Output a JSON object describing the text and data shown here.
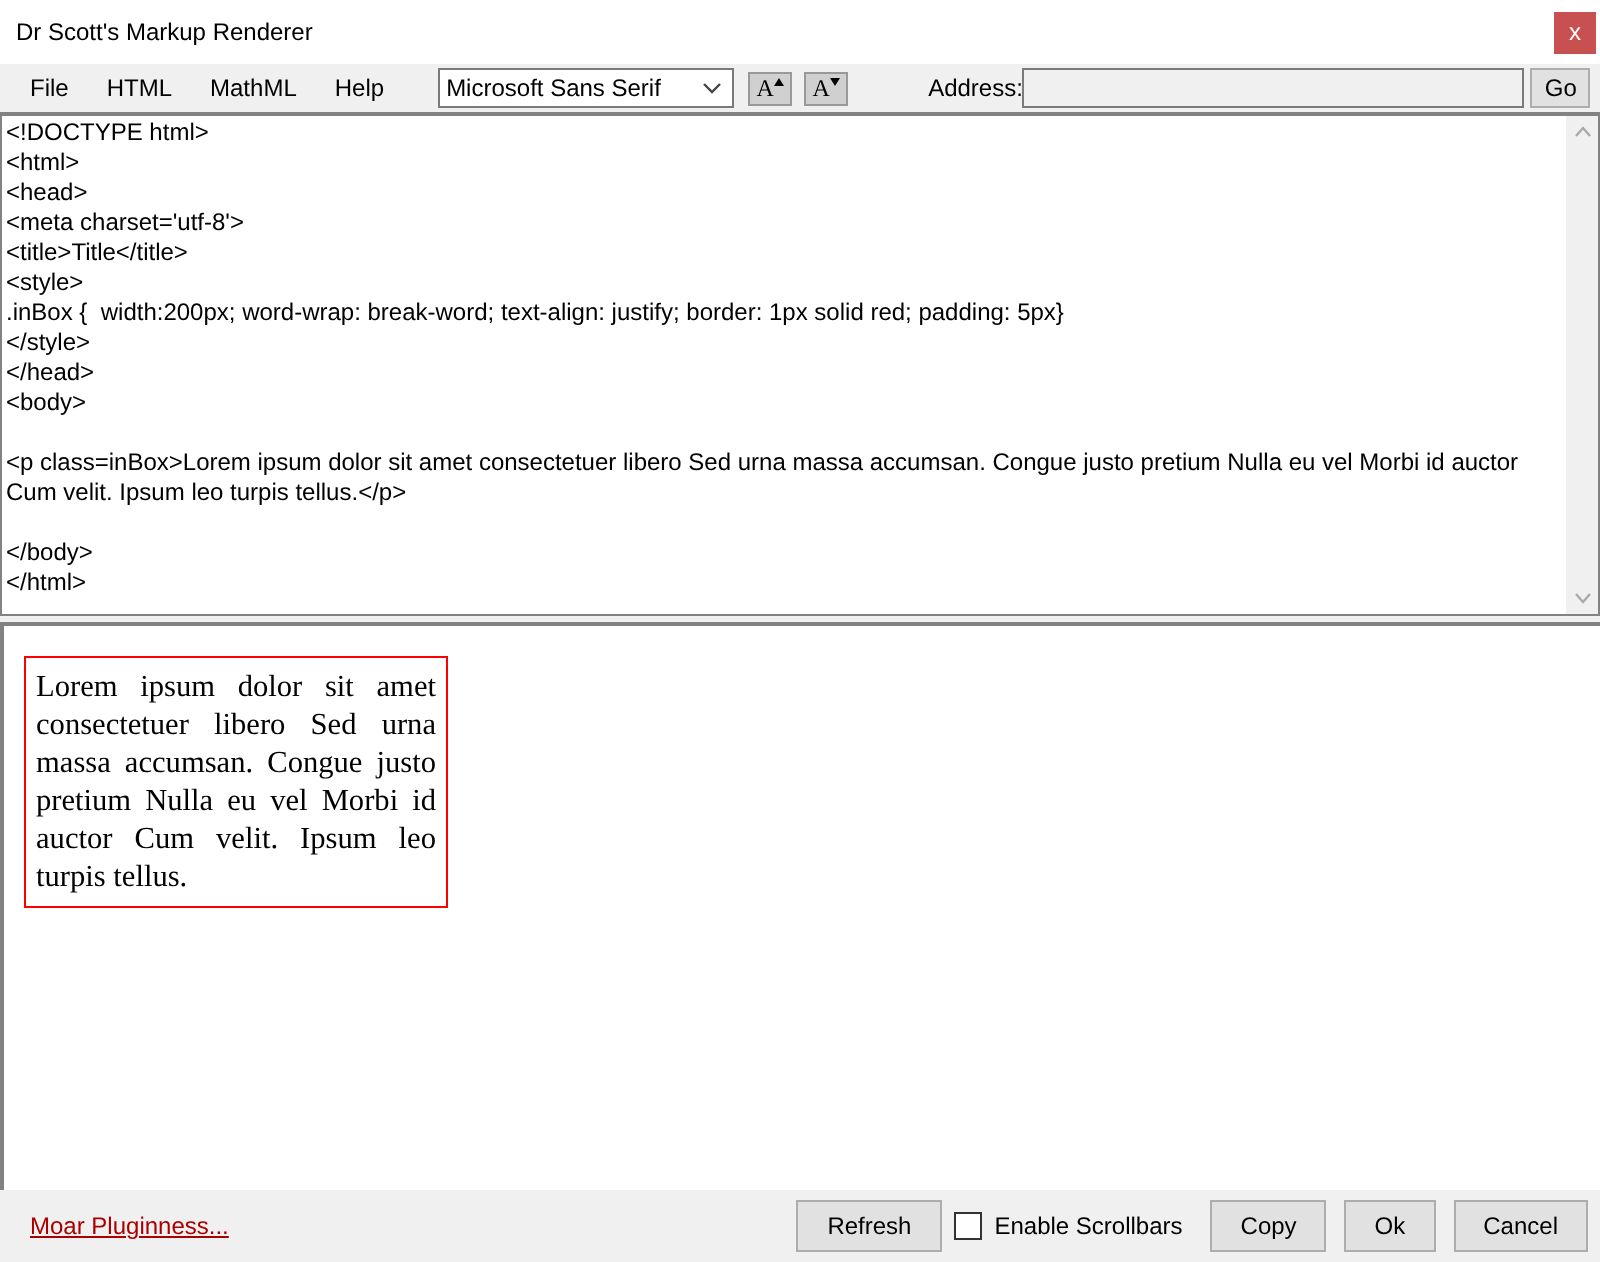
{
  "window": {
    "title": "Dr Scott's Markup Renderer",
    "close": "x"
  },
  "menu": [
    "File",
    "HTML",
    "MathML",
    "Help"
  ],
  "font_select": {
    "value": "Microsoft Sans Serif"
  },
  "font_buttons": [
    {
      "label": "A",
      "kind": "increase"
    },
    {
      "label": "A",
      "kind": "decrease"
    }
  ],
  "address": {
    "label": "Address:",
    "button": "Go"
  },
  "editor": {
    "text": "<!DOCTYPE html>\n<html>\n<head>\n<meta charset='utf-8'>\n<title>Title</title>\n<style>\n.inBox {  width:200px; word-wrap: break-word; text-align: justify; border: 1px solid red; padding: 5px}\n</style>\n</head>\n<body>\n\n<p class=inBox>Lorem ipsum dolor sit amet consectetuer libero Sed urna massa accumsan. Congue justo pretium Nulla eu vel Morbi id auctor Cum velit. Ipsum leo turpis tellus.</p>\n\n</body>\n</html>"
  },
  "preview": {
    "paragraph": "Lorem ipsum dolor sit amet consectetuer libero Sed urna massa accumsan. Congue justo pretium Nulla eu vel Morbi id auctor Cum velit. Ipsum leo turpis tellus."
  },
  "footer": {
    "link": "Moar Pluginness...",
    "refresh": "Refresh",
    "scrollbars": {
      "label": "Enable Scrollbars",
      "checked": false
    },
    "buttons": [
      "Copy",
      "Ok",
      "Cancel"
    ]
  }
}
